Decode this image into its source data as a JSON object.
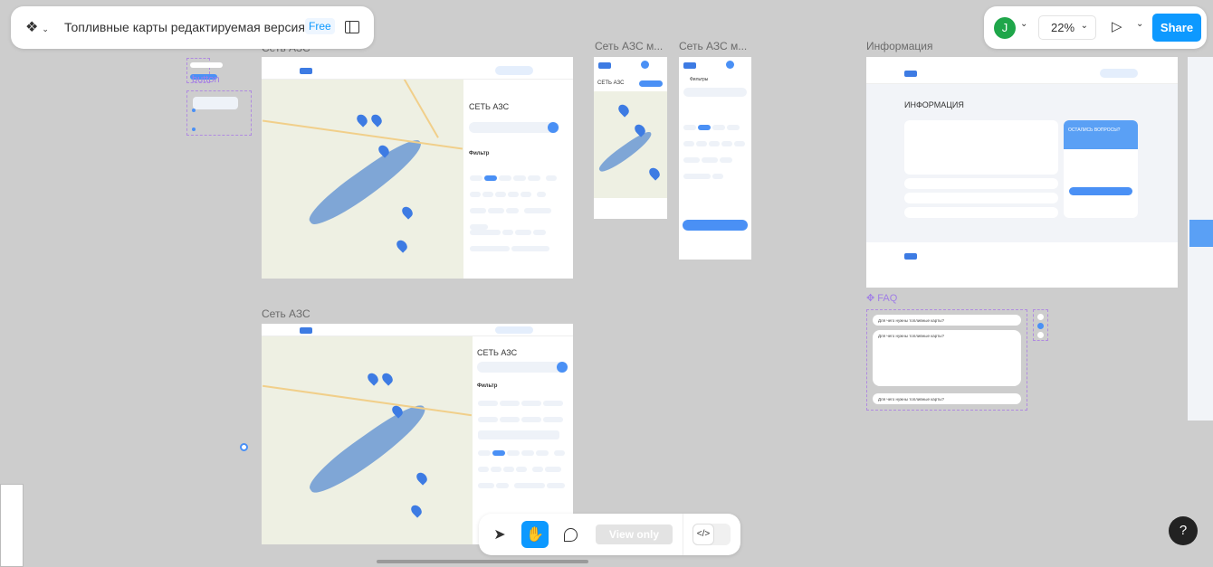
{
  "file": {
    "title": "Топливные карты редактируемая версия",
    "plan_badge": "Free"
  },
  "right_toolbar": {
    "avatar_initial": "J",
    "avatar_color": "#1fa64a",
    "zoom": "22%",
    "share_label": "Share",
    "accent": "#0d99ff"
  },
  "frames": {
    "desktop_1": {
      "label": "Сеть АЗС",
      "heading": "СЕТЬ АЗС",
      "filter": "Фильтр"
    },
    "desktop_2": {
      "label": "Сеть АЗС",
      "heading": "СЕТЬ АЗС",
      "filter": "Фильтр"
    },
    "mobile_1": {
      "label": "Сеть АЗС м...",
      "heading": "СЕТЬ АЗС"
    },
    "mobile_2": {
      "label": "Сеть АЗС м...",
      "heading": "Фильтры"
    },
    "info": {
      "label": "Информация",
      "heading": "ИНФОРМАЦИЯ",
      "cta": "ОСТАЛИСЬ ВОПРОСЫ?"
    }
  },
  "components": {
    "button_label": "button",
    "faq_label": "FAQ",
    "faq_items": [
      "Для чего нужны топливные карты?",
      "Для чего нужны топливные карты?",
      "Для чего нужны топливные карты?"
    ]
  },
  "bottom_toolbar": {
    "view_only": "View only",
    "code_icon": "</>"
  },
  "help": "?"
}
